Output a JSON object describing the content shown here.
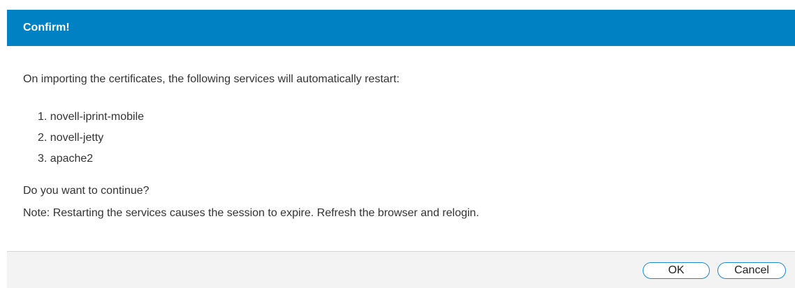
{
  "dialog": {
    "title": "Confirm!",
    "intro": "On importing the certificates, the following services will automatically restart:",
    "services": [
      "1. novell-iprint-mobile",
      "2. novell-jetty",
      "3. apache2"
    ],
    "question": "Do you want to continue?",
    "note": "Note: Restarting the services causes the session to expire. Refresh the browser and relogin."
  },
  "buttons": {
    "ok_label": "OK",
    "cancel_label": "Cancel"
  },
  "colors": {
    "title_bar": "#0081c3",
    "button_border": "#1a8bcf",
    "footer_bg": "#f3f3f3"
  }
}
